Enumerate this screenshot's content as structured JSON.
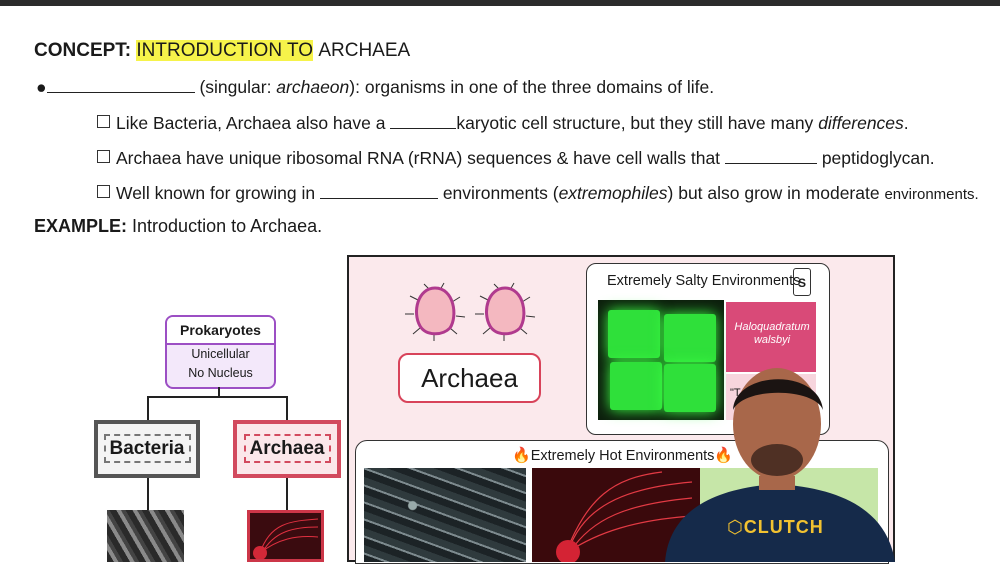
{
  "concept": {
    "label": "CONCEPT:",
    "highlight": "INTRODUCTION TO",
    "rest": "ARCHAEA"
  },
  "bullets": {
    "main": "(singular: archaeon): organisms in one of the three domains of life.",
    "sub1_a": "Like Bacteria, Archaea also have a",
    "sub1_b": "karyotic cell structure, but they still have many",
    "sub1_c": "differences",
    "sub1_d": ".",
    "sub2_a": "Archaea have unique ribosomal RNA (rRNA) sequences & have cell walls that",
    "sub2_b": "peptidoglycan.",
    "sub3_a": "Well known for growing in",
    "sub3_b": "environments (",
    "sub3_c": "extremophiles",
    "sub3_d": ") but also grow in moderate",
    "sub3_e": "environments."
  },
  "main_prefix": "(singular: ",
  "main_italic": "archaeon",
  "main_suffix": "): organisms in one of the three domains of life.",
  "example": {
    "label": "EXAMPLE:",
    "text": "Introduction to Archaea."
  },
  "diagram": {
    "prokaryotes": "Prokaryotes",
    "unicellular": "Unicellular",
    "no_nucleus": "No Nucleus",
    "bacteria": "Bacteria",
    "archaea": "Archaea",
    "archaea_big": "Archaea",
    "salty_title": "Extremely Salty Environments",
    "salt_letter": "S",
    "species": "Haloquadratum walsbyi",
    "species2": "\"T",
    "hot_title": "Extremely Hot Environments"
  },
  "brand": "CLUTCH",
  "colors": {
    "highlight": "#f6f34a",
    "purple": "#9c4fc4",
    "archaea_red": "#d24a5e",
    "panel_pink": "#fbe9ec"
  }
}
